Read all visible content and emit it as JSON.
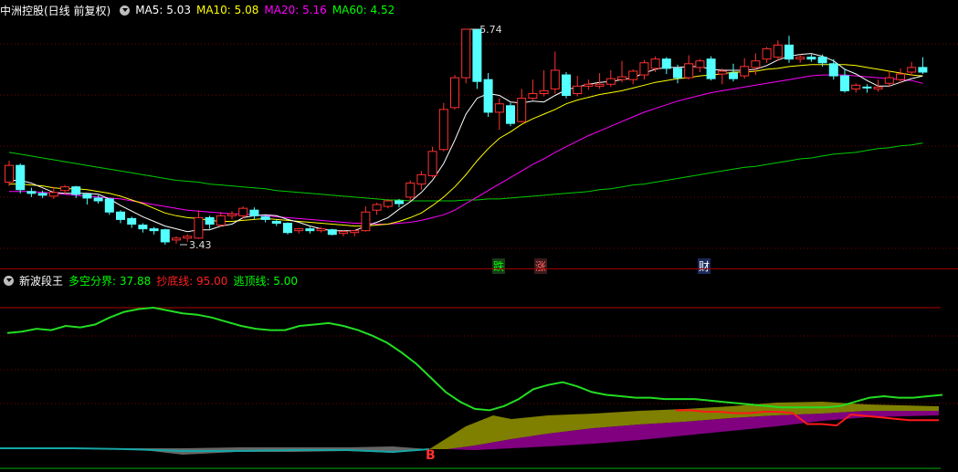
{
  "top_header": {
    "title": "中洲控股(日线 前复权)",
    "indicators": [
      {
        "label": "MA5: 5.03",
        "color": "#ffffff"
      },
      {
        "label": "MA10: 5.08",
        "color": "#ffff00"
      },
      {
        "label": "MA20: 5.16",
        "color": "#ff00ff"
      },
      {
        "label": "MA60: 4.52",
        "color": "#00ff00"
      }
    ]
  },
  "bottom_header": {
    "title": "新波段王",
    "indicators": [
      {
        "label": "多空分界: 37.88",
        "color": "#00ff00"
      },
      {
        "label": "抄底线: 95.00",
        "color": "#ff2020"
      },
      {
        "label": "逃顶线: 5.00",
        "color": "#00ff00"
      }
    ]
  },
  "annotations": {
    "high_label": "5.74",
    "low_label": "3.43",
    "b_marker": "B"
  },
  "markers": [
    {
      "text": "跌",
      "color": "#00ff00",
      "bg": "#1a3a1a"
    },
    {
      "text": "涨",
      "color": "#ff6060",
      "bg": "#3a1a1a"
    },
    {
      "text": "财",
      "color": "#ffffff",
      "bg": "#1a2a5a"
    }
  ],
  "colors": {
    "up": "#ff3030",
    "down": "#54ffff",
    "ma5": "#ffffff",
    "ma10": "#ffff00",
    "ma20": "#ff00ff",
    "ma60": "#00cc00",
    "grid": "#7a0000"
  },
  "chart_data": {
    "type": "candlestick",
    "series": [
      {
        "name": "candles",
        "values": [
          [
            4.1,
            4.28,
            4.06,
            4.33
          ],
          [
            4.28,
            4.02,
            3.98,
            4.3
          ],
          [
            4.0,
            3.98,
            3.94,
            4.04
          ],
          [
            3.98,
            3.96,
            3.93,
            4.01
          ],
          [
            3.95,
            3.99,
            3.92,
            4.05
          ],
          [
            4.01,
            4.05,
            3.97,
            4.07
          ],
          [
            4.05,
            3.97,
            3.93,
            4.06
          ],
          [
            3.97,
            3.93,
            3.86,
            3.98
          ],
          [
            3.93,
            3.9,
            3.87,
            3.96
          ],
          [
            3.92,
            3.78,
            3.75,
            3.93
          ],
          [
            3.78,
            3.7,
            3.66,
            3.8
          ],
          [
            3.71,
            3.65,
            3.61,
            3.73
          ],
          [
            3.64,
            3.6,
            3.56,
            3.66
          ],
          [
            3.6,
            3.58,
            3.54,
            3.62
          ],
          [
            3.59,
            3.46,
            3.43,
            3.6
          ],
          [
            3.48,
            3.5,
            3.44,
            3.52
          ],
          [
            3.5,
            3.52,
            3.46,
            3.54
          ],
          [
            3.5,
            3.72,
            3.49,
            3.8
          ],
          [
            3.72,
            3.65,
            3.6,
            3.74
          ],
          [
            3.64,
            3.74,
            3.62,
            3.78
          ],
          [
            3.74,
            3.76,
            3.7,
            3.79
          ],
          [
            3.74,
            3.82,
            3.71,
            3.84
          ],
          [
            3.8,
            3.74,
            3.7,
            3.83
          ],
          [
            3.73,
            3.7,
            3.67,
            3.75
          ],
          [
            3.68,
            3.66,
            3.63,
            3.7
          ],
          [
            3.66,
            3.56,
            3.54,
            3.67
          ],
          [
            3.58,
            3.6,
            3.55,
            3.61
          ],
          [
            3.6,
            3.58,
            3.55,
            3.62
          ],
          [
            3.58,
            3.6,
            3.56,
            3.62
          ],
          [
            3.59,
            3.54,
            3.53,
            3.6
          ],
          [
            3.55,
            3.57,
            3.52,
            3.58
          ],
          [
            3.56,
            3.58,
            3.52,
            3.59
          ],
          [
            3.58,
            3.78,
            3.57,
            3.84
          ],
          [
            3.8,
            3.86,
            3.75,
            3.88
          ],
          [
            3.84,
            3.9,
            3.82,
            3.92
          ],
          [
            3.9,
            3.87,
            3.83,
            3.92
          ],
          [
            3.94,
            4.09,
            3.9,
            4.12
          ],
          [
            4.08,
            4.18,
            4.02,
            4.22
          ],
          [
            4.17,
            4.43,
            4.15,
            4.48
          ],
          [
            4.45,
            4.88,
            4.43,
            4.95
          ],
          [
            4.9,
            5.22,
            4.88,
            5.25
          ],
          [
            5.22,
            5.74,
            5.16,
            5.74
          ],
          [
            5.74,
            5.18,
            5.1,
            5.74
          ],
          [
            5.2,
            4.85,
            4.8,
            5.27
          ],
          [
            4.85,
            4.94,
            4.66,
            5.0
          ],
          [
            4.92,
            4.73,
            4.7,
            4.95
          ],
          [
            4.75,
            5.0,
            4.74,
            5.1
          ],
          [
            5.0,
            5.05,
            4.98,
            5.2
          ],
          [
            5.05,
            5.08,
            5.02,
            5.3
          ],
          [
            5.1,
            5.3,
            5.05,
            5.5
          ],
          [
            5.25,
            5.03,
            5.0,
            5.28
          ],
          [
            5.05,
            5.13,
            5.02,
            5.24
          ],
          [
            5.13,
            5.15,
            5.09,
            5.2
          ],
          [
            5.13,
            5.15,
            5.1,
            5.27
          ],
          [
            5.15,
            5.21,
            5.12,
            5.3
          ],
          [
            5.2,
            5.23,
            5.17,
            5.4
          ],
          [
            5.2,
            5.29,
            5.15,
            5.31
          ],
          [
            5.25,
            5.38,
            5.2,
            5.41
          ],
          [
            5.32,
            5.42,
            5.28,
            5.45
          ],
          [
            5.42,
            5.32,
            5.26,
            5.44
          ],
          [
            5.32,
            5.22,
            5.16,
            5.36
          ],
          [
            5.22,
            5.37,
            5.2,
            5.46
          ],
          [
            5.33,
            5.4,
            5.28,
            5.42
          ],
          [
            5.42,
            5.21,
            5.19,
            5.45
          ],
          [
            5.26,
            5.29,
            5.15,
            5.32
          ],
          [
            5.27,
            5.21,
            5.18,
            5.37
          ],
          [
            5.24,
            5.34,
            5.21,
            5.43
          ],
          [
            5.33,
            5.4,
            5.25,
            5.48
          ],
          [
            5.42,
            5.53,
            5.38,
            5.55
          ],
          [
            5.44,
            5.57,
            5.4,
            5.62
          ],
          [
            5.57,
            5.42,
            5.38,
            5.67
          ],
          [
            5.42,
            5.44,
            5.38,
            5.47
          ],
          [
            5.44,
            5.42,
            5.39,
            5.47
          ],
          [
            5.44,
            5.38,
            5.34,
            5.47
          ],
          [
            5.37,
            5.24,
            5.2,
            5.42
          ],
          [
            5.24,
            5.08,
            5.06,
            5.32
          ],
          [
            5.1,
            5.14,
            5.06,
            5.16
          ],
          [
            5.12,
            5.11,
            5.06,
            5.15
          ],
          [
            5.1,
            5.12,
            5.07,
            5.2
          ],
          [
            5.16,
            5.22,
            5.12,
            5.29
          ],
          [
            5.2,
            5.26,
            5.16,
            5.32
          ],
          [
            5.28,
            5.33,
            5.24,
            5.39
          ],
          [
            5.33,
            5.28,
            5.26,
            5.44
          ]
        ]
      },
      {
        "name": "MA5",
        "values": [
          4.12,
          4.12,
          4.09,
          4.04,
          3.99,
          3.98,
          3.98,
          3.98,
          3.97,
          3.92,
          3.85,
          3.79,
          3.73,
          3.68,
          3.63,
          3.6,
          3.57,
          3.59,
          3.59,
          3.63,
          3.65,
          3.72,
          3.74,
          3.75,
          3.74,
          3.7,
          3.67,
          3.63,
          3.6,
          3.58,
          3.58,
          3.58,
          3.63,
          3.67,
          3.72,
          3.81,
          3.89,
          3.99,
          4.12,
          4.3,
          4.55,
          4.83,
          5.0,
          5.05,
          5.03,
          4.96,
          4.95,
          4.97,
          4.96,
          5.03,
          5.09,
          5.12,
          5.15,
          5.17,
          5.18,
          5.2,
          5.22,
          5.27,
          5.31,
          5.33,
          5.33,
          5.34,
          5.34,
          5.31,
          5.3,
          5.3,
          5.3,
          5.31,
          5.35,
          5.41,
          5.45,
          5.47,
          5.48,
          5.45,
          5.4,
          5.31,
          5.26,
          5.19,
          5.13,
          5.13,
          5.17,
          5.21,
          5.24
        ]
      },
      {
        "name": "MA10",
        "values": [
          4.08,
          4.08,
          4.07,
          4.06,
          4.04,
          4.03,
          4.03,
          4.02,
          4.0,
          3.98,
          3.95,
          3.91,
          3.87,
          3.82,
          3.77,
          3.74,
          3.72,
          3.71,
          3.69,
          3.68,
          3.68,
          3.69,
          3.7,
          3.71,
          3.7,
          3.69,
          3.68,
          3.67,
          3.66,
          3.65,
          3.64,
          3.63,
          3.63,
          3.64,
          3.65,
          3.68,
          3.72,
          3.77,
          3.85,
          3.94,
          4.05,
          4.18,
          4.33,
          4.46,
          4.57,
          4.64,
          4.72,
          4.78,
          4.83,
          4.88,
          4.94,
          4.98,
          5.01,
          5.04,
          5.06,
          5.08,
          5.11,
          5.14,
          5.17,
          5.19,
          5.21,
          5.22,
          5.24,
          5.25,
          5.26,
          5.28,
          5.28,
          5.29,
          5.31,
          5.32,
          5.34,
          5.35,
          5.36,
          5.36,
          5.36,
          5.36,
          5.35,
          5.33,
          5.31,
          5.29,
          5.27,
          5.25,
          5.24
        ]
      },
      {
        "name": "MA20",
        "values": [
          4.0,
          4.0,
          4.0,
          3.99,
          3.98,
          3.97,
          3.96,
          3.95,
          3.94,
          3.93,
          3.92,
          3.9,
          3.88,
          3.86,
          3.84,
          3.82,
          3.8,
          3.79,
          3.78,
          3.77,
          3.76,
          3.76,
          3.75,
          3.74,
          3.73,
          3.72,
          3.71,
          3.7,
          3.69,
          3.68,
          3.67,
          3.66,
          3.66,
          3.65,
          3.65,
          3.66,
          3.67,
          3.69,
          3.72,
          3.75,
          3.8,
          3.87,
          3.94,
          4.01,
          4.08,
          4.15,
          4.22,
          4.29,
          4.35,
          4.42,
          4.48,
          4.54,
          4.6,
          4.65,
          4.7,
          4.75,
          4.8,
          4.85,
          4.89,
          4.93,
          4.97,
          5.0,
          5.03,
          5.06,
          5.08,
          5.1,
          5.12,
          5.14,
          5.16,
          5.18,
          5.2,
          5.22,
          5.24,
          5.25,
          5.25,
          5.25,
          5.24,
          5.23,
          5.22,
          5.21,
          5.2,
          5.19,
          5.16
        ]
      },
      {
        "name": "MA60",
        "values": [
          4.42,
          4.4,
          4.38,
          4.36,
          4.34,
          4.32,
          4.3,
          4.28,
          4.26,
          4.24,
          4.22,
          4.2,
          4.18,
          4.16,
          4.14,
          4.12,
          4.11,
          4.1,
          4.08,
          4.07,
          4.06,
          4.05,
          4.04,
          4.03,
          4.01,
          4.0,
          3.99,
          3.98,
          3.97,
          3.96,
          3.95,
          3.94,
          3.93,
          3.92,
          3.91,
          3.91,
          3.9,
          3.9,
          3.9,
          3.9,
          3.9,
          3.91,
          3.91,
          3.92,
          3.92,
          3.93,
          3.94,
          3.95,
          3.96,
          3.97,
          3.98,
          3.99,
          4.0,
          4.02,
          4.03,
          4.05,
          4.07,
          4.08,
          4.1,
          4.12,
          4.14,
          4.16,
          4.18,
          4.2,
          4.22,
          4.24,
          4.26,
          4.27,
          4.29,
          4.31,
          4.33,
          4.35,
          4.36,
          4.38,
          4.4,
          4.41,
          4.42,
          4.44,
          4.46,
          4.47,
          4.49,
          4.5,
          4.52
        ]
      },
      {
        "name": "多空分界",
        "values": [
          82,
          83,
          85,
          84,
          87,
          86,
          88,
          93,
          97,
          99,
          100,
          98,
          96,
          95,
          93,
          90,
          87,
          85,
          84,
          84,
          87,
          88,
          89,
          87,
          84,
          80,
          75,
          68,
          60,
          50,
          40,
          33,
          28,
          27,
          30,
          35,
          42,
          45,
          47,
          44,
          40,
          38,
          37,
          36,
          36,
          35,
          35,
          35,
          34,
          33,
          32,
          31,
          30,
          29,
          29,
          29,
          29,
          30,
          33,
          36,
          37,
          36,
          36,
          37,
          38
        ]
      },
      {
        "name": "抄底线",
        "values": [
          27,
          27,
          26,
          26,
          25,
          25,
          26,
          26,
          25,
          25,
          25,
          24,
          24,
          23,
          22,
          21,
          20,
          20,
          20
        ]
      },
      {
        "name": "逃顶线",
        "values": [
          27,
          27,
          26,
          26,
          25,
          25,
          26,
          26,
          25,
          25,
          25,
          24,
          24,
          23,
          23,
          22,
          22,
          22,
          22
        ]
      }
    ]
  }
}
